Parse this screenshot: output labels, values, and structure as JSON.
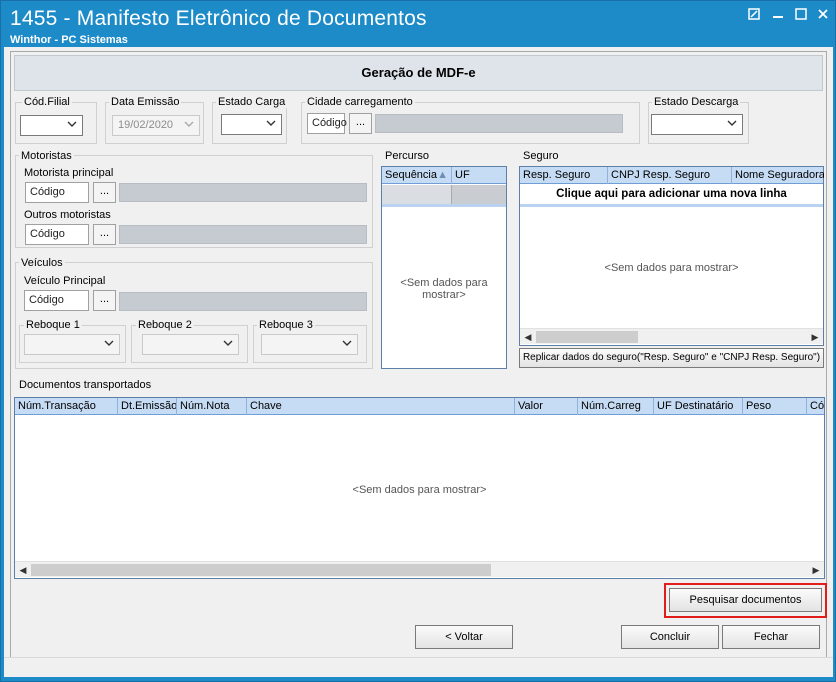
{
  "window": {
    "title": "1455 - Manifesto Eletrônico de Documentos",
    "subtitle": "Winthor - PC Sistemas"
  },
  "header": {
    "title": "Geração de MDF-e"
  },
  "fields": {
    "cod_filial": {
      "label": "Cód.Filial",
      "value": ""
    },
    "data_emissao": {
      "label": "Data Emissão",
      "value": "19/02/2020"
    },
    "estado_carga": {
      "label": "Estado Carga",
      "value": ""
    },
    "cidade_carregamento": {
      "label": "Cidade carregamento",
      "code_placeholder": "Código",
      "browse_label": "..."
    },
    "estado_descarga": {
      "label": "Estado Descarga",
      "value": ""
    }
  },
  "motoristas": {
    "title": "Motoristas",
    "principal_label": "Motorista principal",
    "outros_label": "Outros motoristas",
    "code_placeholder": "Código",
    "browse_label": "..."
  },
  "veiculos": {
    "title": "Veículos",
    "principal_label": "Veículo Principal",
    "code_placeholder": "Código",
    "browse_label": "...",
    "reboque1_label": "Reboque 1",
    "reboque2_label": "Reboque 2",
    "reboque3_label": "Reboque 3"
  },
  "percurso": {
    "title": "Percurso",
    "columns": [
      "Sequência",
      "UF"
    ],
    "empty_text": "<Sem dados para mostrar>"
  },
  "seguro": {
    "title": "Seguro",
    "columns": [
      "Resp. Seguro",
      "CNPJ Resp. Seguro",
      "Nome Seguradora"
    ],
    "new_row_text": "Clique aqui para adicionar uma nova linha",
    "empty_text": "<Sem dados para mostrar>",
    "replicate_button": "Replicar dados do seguro(\"Resp. Seguro\" e \"CNPJ Resp. Seguro\")"
  },
  "documentos": {
    "title": "Documentos transportados",
    "columns": [
      "Núm.Transação",
      "Dt.Emissão",
      "Núm.Nota",
      "Chave",
      "Valor",
      "Núm.Carreg",
      "UF Destinatário",
      "Peso",
      "Cód"
    ],
    "empty_text": "<Sem dados para mostrar>"
  },
  "buttons": {
    "pesquisar": "Pesquisar documentos",
    "voltar": "< Voltar",
    "concluir": "Concluir",
    "fechar": "Fechar"
  },
  "icons": [
    "minimize-icon",
    "restore-icon",
    "close-icon",
    "chevron-down-icon",
    "sort-asc-icon"
  ],
  "colors": {
    "titlebar": "#1e8bc9",
    "grid_header": "#c6dcf5",
    "highlight_box": "#e21b1b"
  }
}
